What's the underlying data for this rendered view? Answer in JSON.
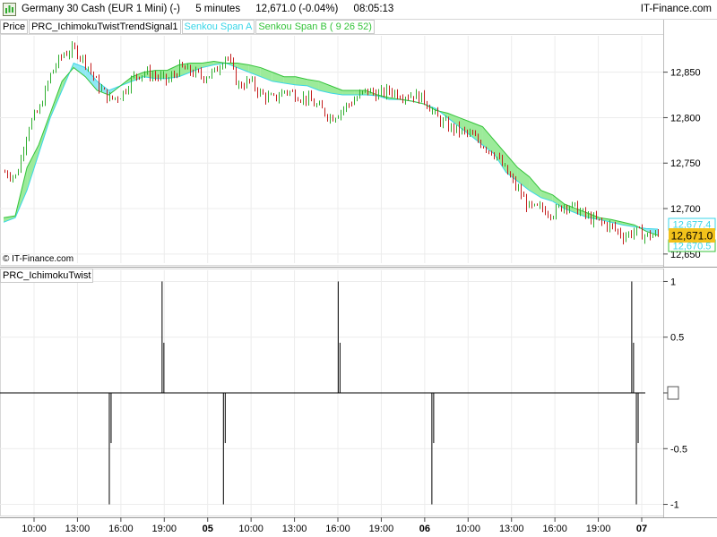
{
  "header": {
    "instrument": "Germany 30 Cash (EUR 1 Mini) (-)",
    "timeframe": "5 minutes",
    "price_change": "12,671.0 (-0.04%)",
    "time": "08:05:13",
    "brand": "IT-Finance.com"
  },
  "legend": {
    "price": "Price",
    "indicator": "PRC_IchimokuTwistTrendSignal1",
    "span_a": "Senkou Span A",
    "span_b": "Senkou Span B ( 9 26 52)"
  },
  "lower_panel_label": "PRC_IchimokuTwist",
  "copyright": "© IT-Finance.com",
  "price_badges": {
    "span_a_value": "12,677.4",
    "last_price": "12,671.0",
    "span_b_value": "12,670.5"
  },
  "colors": {
    "span_a": "#39d6e8",
    "span_b": "#35c33a",
    "cloud_cyan": "#8fe8f4",
    "cloud_green": "#9ceb9a",
    "candle_up": "#2fae2f",
    "candle_down": "#c41e1e",
    "last_price_badge": "#f2c21b"
  },
  "x_axis": {
    "labels": [
      "10:00",
      "13:00",
      "16:00",
      "19:00",
      "05",
      "10:00",
      "13:00",
      "16:00",
      "19:00",
      "06",
      "10:00",
      "13:00",
      "16:00",
      "19:00",
      "07"
    ]
  },
  "chart_data": [
    {
      "type": "line",
      "panel": "price",
      "y_ticks": [
        "12,850",
        "12,800",
        "12,750",
        "12,700",
        "12,650"
      ],
      "ylim": [
        12640,
        12890
      ],
      "series": [
        {
          "name": "Price",
          "values": [
            12740,
            12735,
            12790,
            12810,
            12850,
            12870,
            12875,
            12860,
            12835,
            12820,
            12825,
            12845,
            12850,
            12845,
            12840,
            12855,
            12850,
            12845,
            12850,
            12870,
            12835,
            12840,
            12825,
            12820,
            12830,
            12825,
            12820,
            12810,
            12800,
            12810,
            12820,
            12830,
            12825,
            12830,
            12825,
            12825,
            12820,
            12800,
            12790,
            12785,
            12780,
            12770,
            12760,
            12740,
            12720,
            12700,
            12700,
            12695,
            12705,
            12700,
            12690,
            12685,
            12680,
            12670,
            12675,
            12670,
            12671
          ]
        },
        {
          "name": "Senkou Span A",
          "values": [
            12685,
            12690,
            12720,
            12760,
            12800,
            12830,
            12860,
            12855,
            12840,
            12830,
            12835,
            12840,
            12845,
            12843,
            12843,
            12845,
            12850,
            12855,
            12858,
            12860,
            12855,
            12850,
            12845,
            12840,
            12838,
            12836,
            12835,
            12830,
            12827,
            12825,
            12825,
            12825,
            12824,
            12820,
            12820,
            12818,
            12815,
            12810,
            12800,
            12790,
            12780,
            12770,
            12760,
            12740,
            12730,
            12720,
            12712,
            12708,
            12700,
            12695,
            12690,
            12688,
            12685,
            12682,
            12680,
            12678,
            12677.4
          ]
        },
        {
          "name": "Senkou Span B ( 9 26 52)",
          "values": [
            12690,
            12692,
            12745,
            12770,
            12805,
            12840,
            12855,
            12845,
            12830,
            12825,
            12835,
            12845,
            12850,
            12852,
            12852,
            12858,
            12860,
            12860,
            12862,
            12860,
            12860,
            12858,
            12855,
            12850,
            12845,
            12845,
            12842,
            12840,
            12835,
            12830,
            12830,
            12830,
            12825,
            12822,
            12820,
            12818,
            12815,
            12808,
            12805,
            12800,
            12795,
            12790,
            12775,
            12760,
            12745,
            12735,
            12720,
            12715,
            12705,
            12700,
            12695,
            12690,
            12688,
            12685,
            12682,
            12675,
            12670.5
          ]
        }
      ]
    },
    {
      "type": "line",
      "panel": "indicator",
      "y_ticks": [
        "1",
        "0.5",
        "0",
        "-0.5",
        "-1"
      ],
      "ylim": [
        -1.1,
        1.1
      ],
      "series": [
        {
          "name": "PRC_IchimokuTwist",
          "spikes": [
            {
              "x_fraction": 0.163,
              "value": -1
            },
            {
              "x_fraction": 0.243,
              "value": 1
            },
            {
              "x_fraction": 0.336,
              "value": -1
            },
            {
              "x_fraction": 0.51,
              "value": 1
            },
            {
              "x_fraction": 0.652,
              "value": -1
            },
            {
              "x_fraction": 0.955,
              "value": 1
            },
            {
              "x_fraction": 0.962,
              "value": -1
            }
          ]
        }
      ]
    }
  ]
}
